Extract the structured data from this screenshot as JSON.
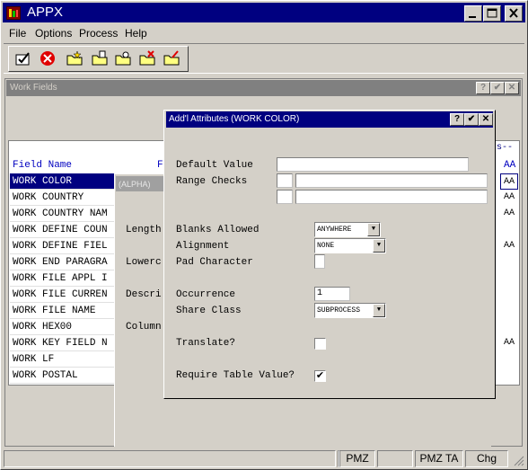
{
  "app": {
    "title": "APPX"
  },
  "menu": {
    "items": [
      "File",
      "Options",
      "Process",
      "Help"
    ]
  },
  "toolbar": {
    "icons": [
      "check-icon",
      "cancel-icon",
      "folder-new-icon",
      "folder-up-icon",
      "folder-search-icon",
      "folder-delete-icon",
      "folder-edit-icon"
    ]
  },
  "workfields": {
    "title": "Work Fields",
    "header_partial_s": "s--",
    "col_field_name": "Field Name",
    "col_f": "F",
    "col_aa": "AA",
    "rows": [
      "WORK COLOR",
      "WORK COUNTRY",
      "WORK COUNTRY NAM",
      "WORK DEFINE COUN",
      "WORK DEFINE FIEL",
      "WORK END PARAGRA",
      "WORK FILE APPL I",
      "WORK FILE CURREN",
      "WORK FILE NAME",
      "WORK HEX00",
      "WORK KEY FIELD N",
      "WORK LF",
      "WORK POSTAL"
    ],
    "aa_values": [
      "AA",
      "AA",
      "AA",
      "",
      "AA",
      "",
      "",
      "",
      "",
      "",
      "AA",
      "",
      ""
    ]
  },
  "middle_panel": {
    "title": "(ALPHA)",
    "labels": {
      "length": "Length",
      "lowercase": "Lowerc",
      "description": "Descri",
      "column": "Column"
    }
  },
  "dialog": {
    "title": "Add'l Attributes (WORK COLOR)",
    "labels": {
      "default_value": "Default Value",
      "range_checks": "Range Checks",
      "blanks_allowed": "Blanks Allowed",
      "alignment": "Alignment",
      "pad_character": "Pad Character",
      "occurrence": "Occurrence",
      "share_class": "Share Class",
      "translate": "Translate?",
      "require_table_value": "Require Table Value?"
    },
    "values": {
      "default_value": "",
      "blanks_allowed": "ANYWHERE",
      "alignment": "NONE",
      "pad_character": "",
      "occurrence": "1",
      "share_class": "SUBPROCESS",
      "translate": "",
      "require_table_value": "✔"
    }
  },
  "statusbar": {
    "cells": [
      "",
      "",
      "PMZ",
      "",
      "PMZ TA",
      "Chg"
    ]
  }
}
